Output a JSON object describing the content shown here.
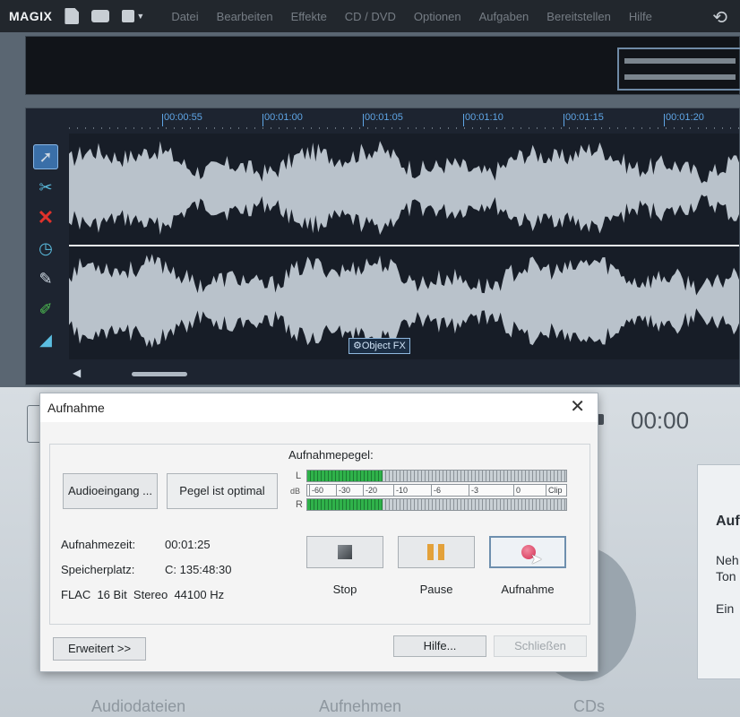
{
  "app": {
    "logo": "MAGIX",
    "menu": [
      "Datei",
      "Bearbeiten",
      "Effekte",
      "CD / DVD",
      "Optionen",
      "Aufgaben",
      "Bereitstellen",
      "Hilfe"
    ]
  },
  "editor": {
    "time_ticks": [
      "00:00:55",
      "00:01:00",
      "00:01:05",
      "00:01:10",
      "00:01:15",
      "00:01:20"
    ],
    "object_fx_label": "Object FX"
  },
  "background": {
    "time_display": "00:00",
    "side_panel_title": "Auf",
    "side_panel_lines": [
      "Neh",
      "Ton",
      "Ein"
    ],
    "bottom_tabs": [
      "Audiodateien",
      "Aufnehmen",
      "CDs"
    ]
  },
  "dialog": {
    "title": "Aufnahme",
    "audio_input_button": "Audioeingang ...",
    "level_status_button": "Pegel ist optimal",
    "level_heading": "Aufnahmepegel:",
    "channel_left": "L",
    "channel_right": "R",
    "db_label": "dB",
    "meter_left_level": 0.29,
    "meter_right_level": 0.29,
    "scale_labels": [
      "-60",
      "-30",
      "-20",
      "-10",
      "-6",
      "-3",
      "0",
      "Clip"
    ],
    "info": {
      "time_label": "Aufnahmezeit:",
      "time_value": "00:01:25",
      "storage_label": "Speicherplatz:",
      "storage_value": "C: 135:48:30",
      "format": "FLAC  16 Bit  Stereo  44100 Hz"
    },
    "transport": {
      "stop": "Stop",
      "pause": "Pause",
      "record": "Aufnahme"
    },
    "advanced_button": "Erweitert >>",
    "help_button": "Hilfe...",
    "close_button": "Schließen"
  },
  "colors": {
    "meter_green": "#2fb24a",
    "record_red": "#e0435a",
    "pause_orange": "#e3a13a",
    "tick_blue": "#5fa6e6"
  }
}
